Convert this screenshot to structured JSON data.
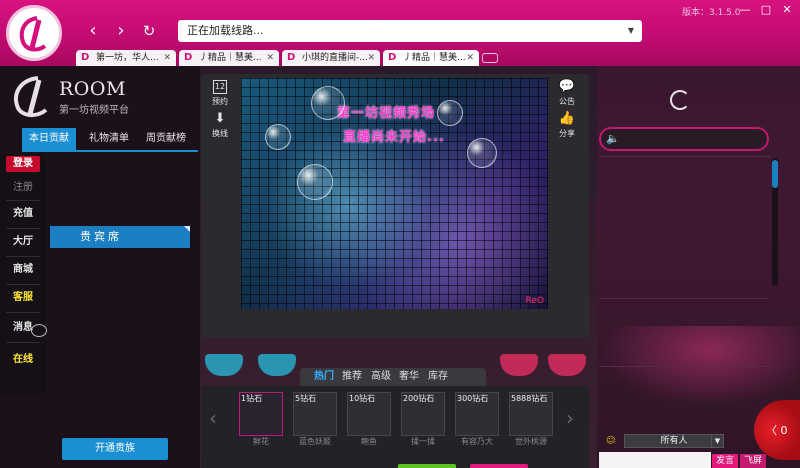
{
  "browser": {
    "address": "正在加载线路...",
    "version": "版本：3.1.5.0",
    "nav": {
      "back": "‹",
      "forward": "›",
      "refresh": "↻"
    },
    "window_controls": {
      "minimize": "—",
      "maximize": "□",
      "close": "✕"
    },
    "tabs": [
      {
        "label": "第一坊，华人...",
        "icon": "D"
      },
      {
        "label": "丿精品｜慧美...",
        "icon": "D"
      },
      {
        "label": "小琪的直播间-...",
        "icon": "D"
      },
      {
        "label": "丿精品｜慧美...",
        "icon": "D"
      }
    ]
  },
  "room": {
    "title": "ROOM",
    "subtitle": "第一坊视频平台",
    "tabs": [
      "本日贡献",
      "礼物清单",
      "周贡献榜"
    ],
    "vip_section": "贵宾席",
    "vip_button": "开通贵族"
  },
  "side_menu": [
    "登录",
    "注册",
    "充值",
    "大厅",
    "商城",
    "客服",
    "消息",
    "在线"
  ],
  "video": {
    "title_line1": "第一坊视频秀场",
    "title_line2": "直播尚未开始...",
    "corner_label": "ReO"
  },
  "tools": {
    "appointment": "预约",
    "switch_line": "换线",
    "announcement": "公告",
    "share": "分享",
    "calendar_day": "12"
  },
  "gifts": {
    "tabs": [
      "热门",
      "推荐",
      "高级",
      "奢华",
      "库存"
    ],
    "items": [
      {
        "price": "1钻石",
        "name": "鲜花"
      },
      {
        "price": "5钻石",
        "name": "蓝色妖姬"
      },
      {
        "price": "10钻石",
        "name": "鲍鱼"
      },
      {
        "price": "200钻石",
        "name": "揉一揉"
      },
      {
        "price": "300钻石",
        "name": "有容乃大"
      },
      {
        "price": "5888钻石",
        "name": "世外桃源"
      }
    ]
  },
  "chat": {
    "target": "所有人",
    "send": "发言",
    "fly": "飞屏",
    "float_label": "〈 0"
  },
  "colors": {
    "brand_pink": "#d4107a",
    "accent_blue": "#1c8fd4",
    "login_red": "#c40b2b"
  }
}
